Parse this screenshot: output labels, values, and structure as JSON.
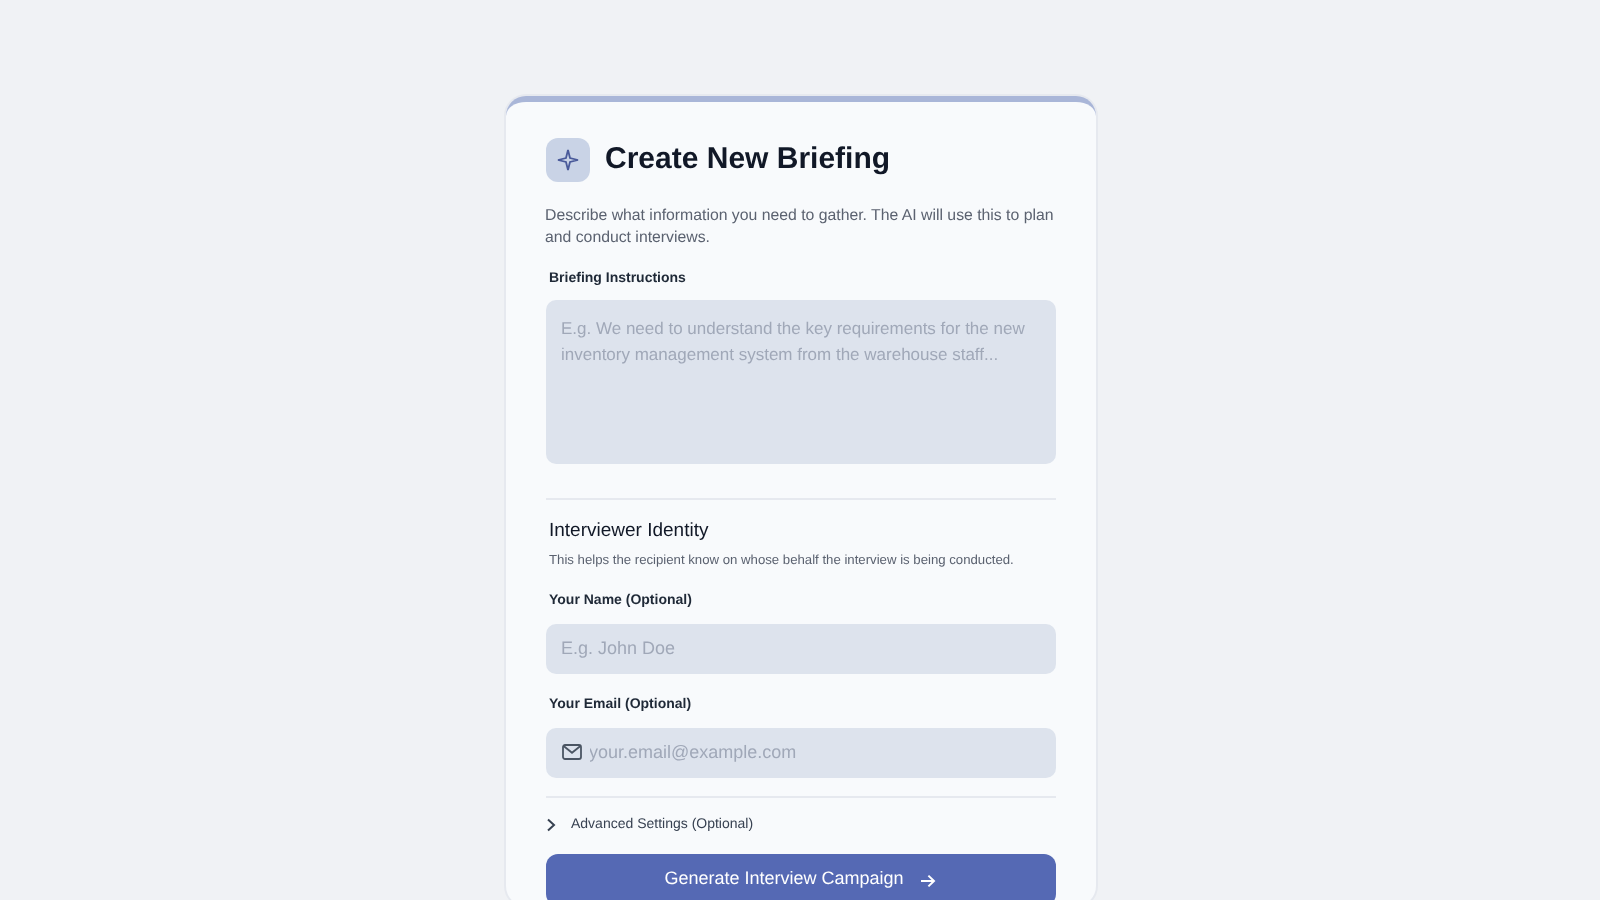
{
  "title": "Create New Briefing",
  "description": "Describe what information you need to gather. The AI will use this to plan and conduct interviews.",
  "briefing": {
    "label": "Briefing Instructions",
    "placeholder": "E.g. We need to understand the key requirements for the new inventory management system from the warehouse staff..."
  },
  "identity": {
    "heading": "Interviewer Identity",
    "hint": "This helps the recipient know on whose behalf the interview is being conducted.",
    "fields": [
      {
        "kind": "text",
        "label": "Your Name (Optional)",
        "placeholder": "E.g. John Doe"
      },
      {
        "kind": "email",
        "label": "Your Email (Optional)",
        "placeholder": "your.email@example.com"
      }
    ]
  },
  "advanced": {
    "label": "Advanced Settings (Optional)",
    "expanded": false
  },
  "submit": {
    "label": "Generate Interview Campaign"
  }
}
